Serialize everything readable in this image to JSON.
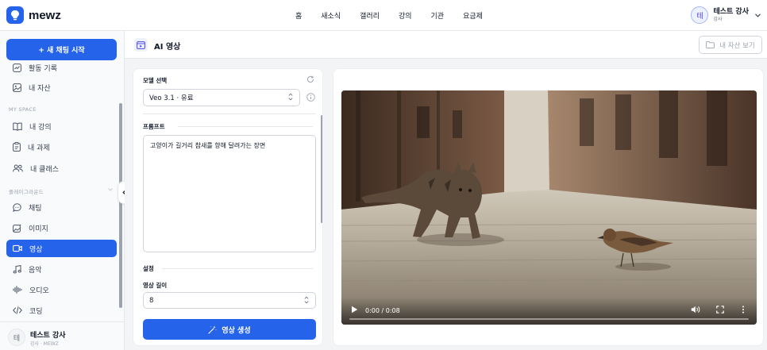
{
  "brand": {
    "name": "mewz",
    "accent": "#2563eb"
  },
  "nav": {
    "items": [
      "홈",
      "새소식",
      "갤러리",
      "강의",
      "기관",
      "요금제"
    ]
  },
  "user": {
    "avatar": "테",
    "name": "테스트 강사",
    "role": "강사"
  },
  "sidebar": {
    "new_chat": "+ 새 채팅 시작",
    "items_top": [
      {
        "label": "활동 기록",
        "icon": "activity-icon"
      },
      {
        "label": "내 자산",
        "icon": "image-icon"
      }
    ],
    "section_my": "MY SPACE",
    "items_my": [
      {
        "label": "내 강의",
        "icon": "book-icon"
      },
      {
        "label": "내 과제",
        "icon": "clipboard-icon"
      },
      {
        "label": "내 클래스",
        "icon": "users-icon"
      }
    ],
    "section_play": "플레이그라운드",
    "items_play": [
      {
        "label": "채팅",
        "icon": "chat-icon"
      },
      {
        "label": "이미지",
        "icon": "image-icon"
      },
      {
        "label": "영상",
        "icon": "video-icon",
        "active": true
      },
      {
        "label": "음악",
        "icon": "music-icon"
      },
      {
        "label": "오디오",
        "icon": "waveform-icon"
      },
      {
        "label": "코딩",
        "icon": "code-icon"
      }
    ],
    "footer": {
      "avatar": "테",
      "name": "테스트 강사",
      "org": "강사 · MEWZ"
    }
  },
  "page": {
    "title": "AI 영상",
    "assets_button": "내 자산 보기"
  },
  "form": {
    "model_label": "모델 선택",
    "model_value": "Veo 3.1 · 유료",
    "prompt_label": "프롬프트",
    "prompt_value": "고양이가 길거리 참새를 향해 달려가는 장면",
    "settings_label": "설정",
    "length_label": "영상 길이",
    "length_value": "8",
    "generate_button": "영상 생성"
  },
  "video": {
    "time": "0:00 / 0:08",
    "progress": 0
  }
}
